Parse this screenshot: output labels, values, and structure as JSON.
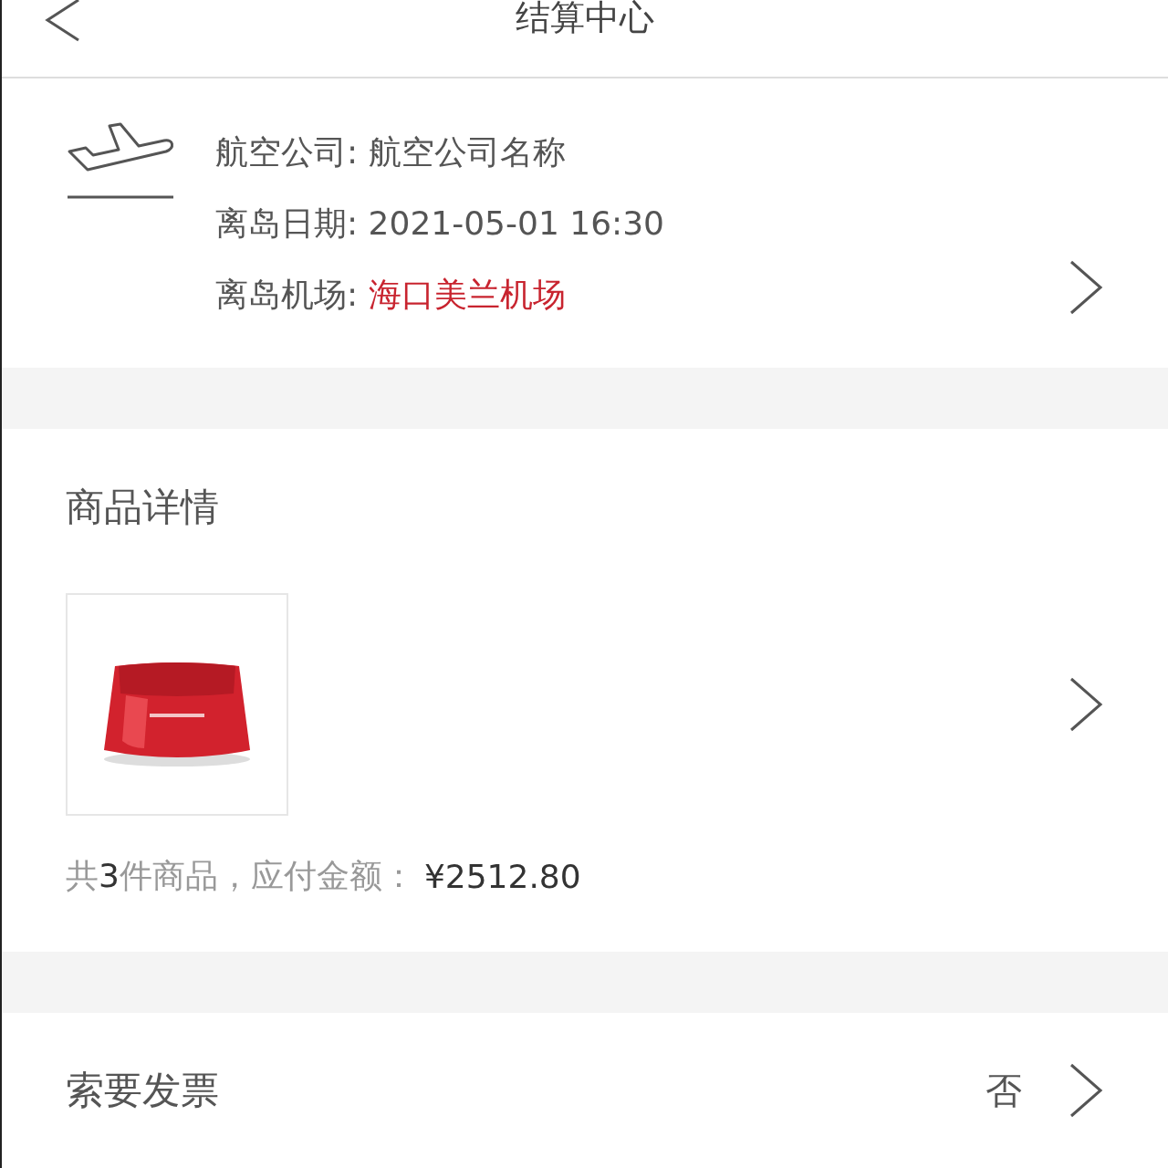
{
  "header": {
    "title": "结算中心"
  },
  "flight": {
    "fields": [
      {
        "label": "航空公司: ",
        "value": "航空公司名称",
        "highlight": false
      },
      {
        "label": "离岛日期: ",
        "value": "2021-05-01 16:30",
        "highlight": false
      },
      {
        "label": "离岛机场: ",
        "value": "海口美兰机场",
        "highlight": true
      }
    ]
  },
  "products": {
    "title": "商品详情",
    "summary": "共**3**件商品，应付金额：",
    "total": "¥2512.80"
  },
  "invoice": {
    "label": "索要发票",
    "value": "否"
  }
}
